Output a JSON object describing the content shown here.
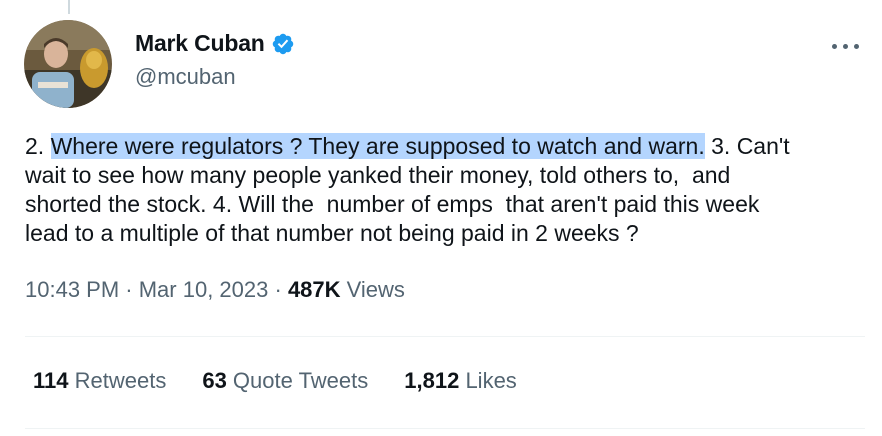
{
  "author": {
    "name": "Mark Cuban",
    "handle": "@mcuban",
    "verified": true,
    "avatar_icon": "profile-photo"
  },
  "tweet": {
    "text_before": "2. ",
    "text_highlighted": "Where were regulators ? They are supposed to watch and warn.",
    "text_after": " 3. Can't\nwait to see how many people yanked their money, told others to,  and\nshorted the stock. 4. Will the  number of emps  that aren't paid this week\nlead to a multiple of that number not being paid in 2 weeks ?"
  },
  "meta": {
    "time": "10:43 PM",
    "sep1": " · ",
    "date": "Mar 10, 2023",
    "sep2": " · ",
    "views_count": "487K",
    "views_label": " Views"
  },
  "stats": {
    "retweets_count": "114",
    "retweets_label": " Retweets",
    "quotes_count": "63",
    "quotes_label": " Quote Tweets",
    "likes_count": "1,812",
    "likes_label": " Likes"
  },
  "colors": {
    "text": "#0f1419",
    "secondary": "#536471",
    "verified": "#1d9bf0",
    "highlight": "#b4d5fe"
  }
}
